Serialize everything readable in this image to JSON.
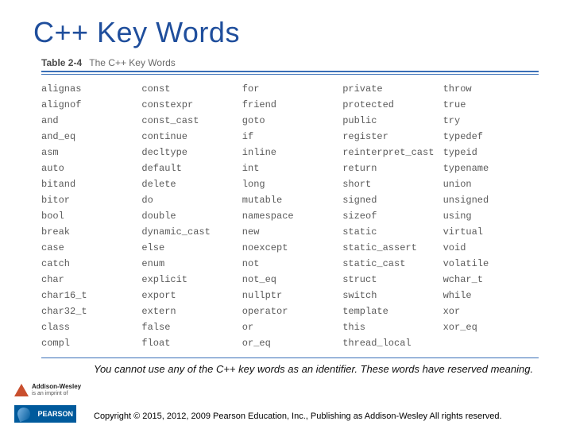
{
  "title": "C++ Key Words",
  "tableLabel": "Table 2-4",
  "tableCaption": "The C++ Key Words",
  "col1": [
    "alignas",
    "alignof",
    "and",
    "and_eq",
    "asm",
    "auto",
    "bitand",
    "bitor",
    "bool",
    "break",
    "case",
    "catch",
    "char",
    "char16_t",
    "char32_t",
    "class",
    "compl"
  ],
  "col2": [
    "const",
    "constexpr",
    "const_cast",
    "continue",
    "decltype",
    "default",
    "delete",
    "do",
    "double",
    "dynamic_cast",
    "else",
    "enum",
    "explicit",
    "export",
    "extern",
    "false",
    "float"
  ],
  "col3": [
    "for",
    "friend",
    "goto",
    "if",
    "inline",
    "int",
    "long",
    "mutable",
    "namespace",
    "new",
    "noexcept",
    "not",
    "not_eq",
    "nullptr",
    "operator",
    "or",
    "or_eq"
  ],
  "col4": [
    "private",
    "protected",
    "public",
    "register",
    "reinterpret_cast",
    "return",
    "short",
    "signed",
    "sizeof",
    "static",
    "static_assert",
    "static_cast",
    "struct",
    "switch",
    "template",
    "this",
    "thread_local"
  ],
  "col5": [
    "throw",
    "true",
    "try",
    "typedef",
    "typeid",
    "typename",
    "union",
    "unsigned",
    "using",
    "virtual",
    "void",
    "volatile",
    "wchar_t",
    "while",
    "xor",
    "xor_eq"
  ],
  "note": "You cannot use any of the C++ key words as an identifier. These words have reserved meaning.",
  "copyright": "Copyright © 2015, 2012, 2009 Pearson Education, Inc., Publishing as Addison-Wesley All rights reserved.",
  "awBrand": "Addison-Wesley",
  "awSub": "is an imprint of",
  "pearson": "PEARSON"
}
